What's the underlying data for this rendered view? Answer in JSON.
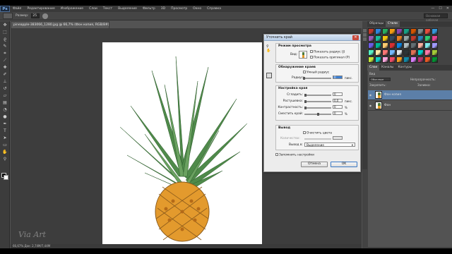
{
  "app": {
    "logo": "Ps",
    "menu": [
      "Файл",
      "Редактирование",
      "Изображение",
      "Слои",
      "Текст",
      "Выделение",
      "Фильтр",
      "3D",
      "Просмотр",
      "Окно",
      "Справка"
    ],
    "win_controls": [
      "—",
      "☐",
      "✕"
    ]
  },
  "options_bar": {
    "size_label": "Размер:",
    "size_value": "25",
    "search_placeholder": "Основная рабочая"
  },
  "document": {
    "tab_title": "pineapple-383066_1280.jpg @ 66,7% (Фон копия, RGB/8#) *",
    "status": "66,67%   Док: 2,74M/7,44M"
  },
  "watermark": "Via Art",
  "dialog": {
    "title": "Уточнить край",
    "close": "✕",
    "view_mode": {
      "title": "Режим просмотра",
      "view_label": "Вид:",
      "show_radius": "Показать радиус (J)",
      "show_original": "Показать оригинал (P)"
    },
    "edge_detection": {
      "title": "Обнаружение краев",
      "smart_radius": "Умный радиус",
      "radius_label": "Радиус:",
      "radius_value": "0",
      "radius_unit": "пикс."
    },
    "adjust_edge": {
      "title": "Настройка края",
      "smooth_label": "Сгладить:",
      "smooth_value": "0",
      "feather_label": "Растушевка:",
      "feather_value": "0,0",
      "feather_unit": "пикс.",
      "contrast_label": "Контрастность:",
      "contrast_value": "0",
      "contrast_unit": "%",
      "shift_label": "Сместить край:",
      "shift_value": "0",
      "shift_unit": "%"
    },
    "output": {
      "title": "Вывод",
      "decontaminate": "Очистить цвета",
      "amount_label": "Количество:",
      "output_to_label": "Вывод в:",
      "output_to_value": "Выделение"
    },
    "remember": "Запомнить настройки",
    "cancel": "Отмена",
    "ok": "OK"
  },
  "panels": {
    "top_tabs": [
      "Образцы",
      "Стили"
    ],
    "layers_tabs": [
      "Слои",
      "Каналы",
      "Контуры"
    ],
    "kind_label": "Вид",
    "blend_mode": "Обычные",
    "opacity_label": "Непрозрачность:",
    "lock_label": "Закрепить:",
    "fill_label": "Заливка:",
    "layers": [
      {
        "name": "Фон копия",
        "selected": true
      },
      {
        "name": "Фон",
        "selected": false
      }
    ],
    "style_colors": [
      "#c0392b",
      "#2e86de",
      "#27ae60",
      "#f39c12",
      "#8e44ad",
      "#16a085",
      "#d35400",
      "#7f8c8d",
      "#e74c3c",
      "#3498db",
      "#9b59b6",
      "#1abc9c",
      "#f1c40f",
      "#34495e",
      "#e67e22",
      "#95a5a6",
      "#c0392b",
      "#2980b9",
      "#2ecc71",
      "#e84393",
      "#6c5ce7",
      "#00b894",
      "#fdcb6e",
      "#d63031",
      "#0984e3",
      "#b2bec3",
      "#636e72",
      "#fab1a0",
      "#81ecec",
      "#a29bfe",
      "#55efc4",
      "#ffeaa7",
      "#ff7675",
      "#74b9ff",
      "#dfe6e9",
      "#2d3436",
      "#e17055",
      "#00cec9",
      "#fd79a8",
      "#a3cb38",
      "#c4e538",
      "#12cbc4",
      "#fda7df",
      "#ed4c67",
      "#f79f1f",
      "#1289a7",
      "#d980fa",
      "#b53471",
      "#ee5a24",
      "#009432"
    ]
  }
}
